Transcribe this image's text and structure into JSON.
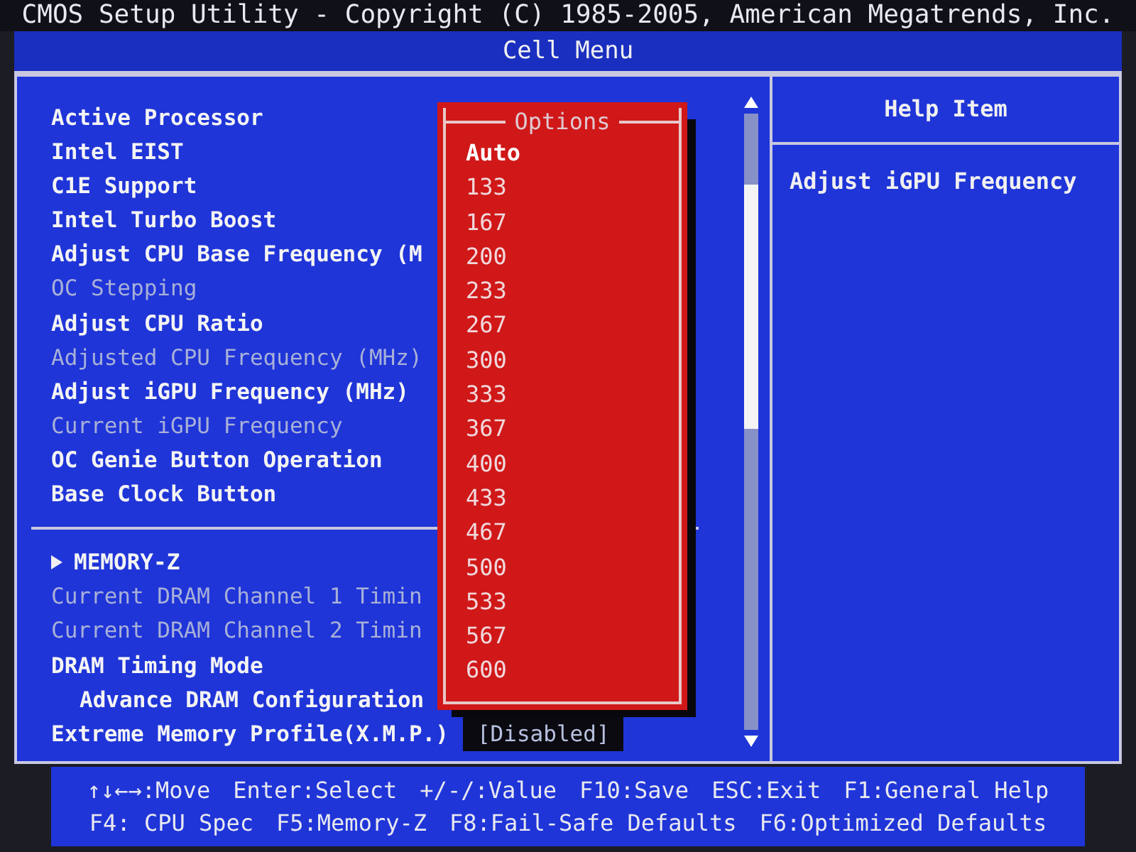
{
  "window": {
    "title": "CMOS Setup Utility - Copyright (C) 1985-2005, American Megatrends, Inc."
  },
  "menu_title": "Cell Menu",
  "settings": [
    {
      "kind": "item",
      "label": "Active Processor",
      "disabled": false
    },
    {
      "kind": "item",
      "label": "Intel EIST",
      "disabled": false
    },
    {
      "kind": "item",
      "label": "C1E Support",
      "disabled": false
    },
    {
      "kind": "item",
      "label": "Intel Turbo Boost",
      "disabled": false
    },
    {
      "kind": "item",
      "label": "Adjust CPU Base Frequency (M",
      "disabled": false
    },
    {
      "kind": "item",
      "label": "OC Stepping",
      "disabled": true
    },
    {
      "kind": "item",
      "label": "Adjust CPU Ratio",
      "disabled": false
    },
    {
      "kind": "item",
      "label": "Adjusted CPU Frequency (MHz)",
      "disabled": true
    },
    {
      "kind": "item",
      "label": "Adjust iGPU Frequency (MHz)",
      "disabled": false
    },
    {
      "kind": "item",
      "label": "Current iGPU Frequency",
      "disabled": true
    },
    {
      "kind": "item",
      "label": "OC Genie Button Operation",
      "disabled": false
    },
    {
      "kind": "item",
      "label": "Base Clock Button",
      "disabled": false
    },
    {
      "kind": "separator"
    },
    {
      "kind": "submenu",
      "label": "MEMORY-Z",
      "disabled": false
    },
    {
      "kind": "item",
      "label": "Current DRAM Channel 1 Timin",
      "disabled": true
    },
    {
      "kind": "item",
      "label": "Current DRAM Channel 2 Timin",
      "disabled": true
    },
    {
      "kind": "item",
      "label": "DRAM Timing Mode",
      "disabled": false
    },
    {
      "kind": "subitem",
      "label": "Advance DRAM Configuration",
      "disabled": false
    },
    {
      "kind": "item",
      "label": "Extreme Memory Profile(X.M.P.)",
      "value": "[Disabled]",
      "disabled": false
    }
  ],
  "options_popup": {
    "title": "Options",
    "options": [
      {
        "label": "Auto",
        "selected": true
      },
      {
        "label": "133",
        "selected": false
      },
      {
        "label": "167",
        "selected": false
      },
      {
        "label": "200",
        "selected": false
      },
      {
        "label": "233",
        "selected": false
      },
      {
        "label": "267",
        "selected": false
      },
      {
        "label": "300",
        "selected": false
      },
      {
        "label": "333",
        "selected": false
      },
      {
        "label": "367",
        "selected": false
      },
      {
        "label": "400",
        "selected": false
      },
      {
        "label": "433",
        "selected": false
      },
      {
        "label": "467",
        "selected": false
      },
      {
        "label": "500",
        "selected": false
      },
      {
        "label": "533",
        "selected": false
      },
      {
        "label": "567",
        "selected": false
      },
      {
        "label": "600",
        "selected": false
      }
    ]
  },
  "help": {
    "title": "Help Item",
    "text": "Adjust iGPU Frequency"
  },
  "key_hints": [
    [
      "↑↓←→:Move",
      "Enter:Select",
      "+/-/:Value",
      "F10:Save",
      "ESC:Exit",
      "F1:General Help"
    ],
    [
      "F4: CPU Spec",
      "F5:Memory-Z",
      "F8:Fail-Safe Defaults",
      "F6:Optimized Defaults"
    ]
  ]
}
